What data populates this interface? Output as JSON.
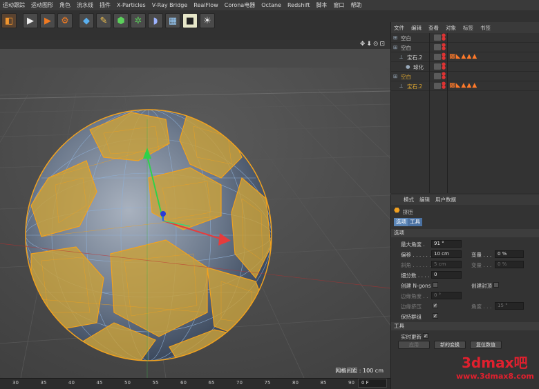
{
  "menubar": [
    "运动跟踪",
    "运动图形",
    "角色",
    "流水线",
    "插件",
    "X-Particles",
    "V-Ray Bridge",
    "RealFlow",
    "Corona电器",
    "Octane",
    "Redshift",
    "脚本",
    "窗口",
    "帮助"
  ],
  "toolbar": {
    "icons": [
      "cube-icon",
      "clapper-icon",
      "clapper-icon",
      "clapper-icon",
      "cube-blue-icon",
      "pen-icon",
      "subdivide-icon",
      "array-icon",
      "deformer-icon",
      "floor-icon",
      "camera-icon",
      "light-icon"
    ]
  },
  "viewport": {
    "nav_icons": "✥⬇⊙⊡",
    "grid_spacing": "网格间距 : 100 cm"
  },
  "timeline": {
    "ticks": [
      "30",
      "35",
      "40",
      "45",
      "50",
      "55",
      "60",
      "65",
      "70",
      "75",
      "80",
      "85",
      "90"
    ],
    "frame": "0 F"
  },
  "object_manager": {
    "menu": [
      "文件",
      "编辑",
      "查看",
      "对象",
      "标签",
      "书签"
    ],
    "rows": [
      {
        "name": "空白",
        "indent": 0,
        "color": "#cfcfcf",
        "tags": ""
      },
      {
        "name": "空白",
        "indent": 0,
        "color": "#cfcfcf",
        "tags": ""
      },
      {
        "name": "宝石.2",
        "indent": 1,
        "color": "#cfcfcf",
        "tags": "▩◣▲▲▲"
      },
      {
        "name": "球化",
        "indent": 2,
        "color": "#cfcfcf",
        "tags": ""
      },
      {
        "name": "空白",
        "indent": 0,
        "color": "#e0a830",
        "tags": ""
      },
      {
        "name": "宝石.2",
        "indent": 1,
        "color": "#e0a830",
        "tags": "▩◣▲▲▲"
      }
    ]
  },
  "attribute_manager": {
    "menu": [
      "模式",
      "编辑",
      "用户数据"
    ],
    "object_name": "挤压",
    "tabs": [
      "选项",
      "工具"
    ],
    "section_options": "选项",
    "section_tool": "工具",
    "fields": {
      "max_angle_label": "最大角度 .",
      "max_angle": "91 °",
      "offset_label": "偏移 . . . . . . .",
      "offset": "10 cm",
      "variance_label": "变量 . . .",
      "variance": "0 %",
      "bevel_label": "斜角 . . . . . . .",
      "bevel": "5 cm",
      "variance2_label": "变量 . . .",
      "variance2": "0 %",
      "subdiv_label": "细分数 . . . .",
      "subdiv": "0",
      "create_ngons": "创建 N-gons",
      "create_caps": "创建封顶",
      "edge_angle_label": "边缘角度 . .",
      "edge_angle": "0 °",
      "edge_smooth": "边缘挤压",
      "angle_label": "角度 . . .",
      "angle": "15 °",
      "keep_groups": "保持群组",
      "realtime": "实时更新",
      "apply": "应用",
      "new_transform": "新的变换",
      "reset": "复位数值"
    }
  },
  "watermark": {
    "brand": "3dmax吧",
    "url": "www.3dmax8.com"
  },
  "colors": {
    "face_gold": "#c9a13a",
    "face_blue": "#5a6b82",
    "wire_orange": "#f2a21e",
    "wire_blue": "#8fb1d8"
  }
}
